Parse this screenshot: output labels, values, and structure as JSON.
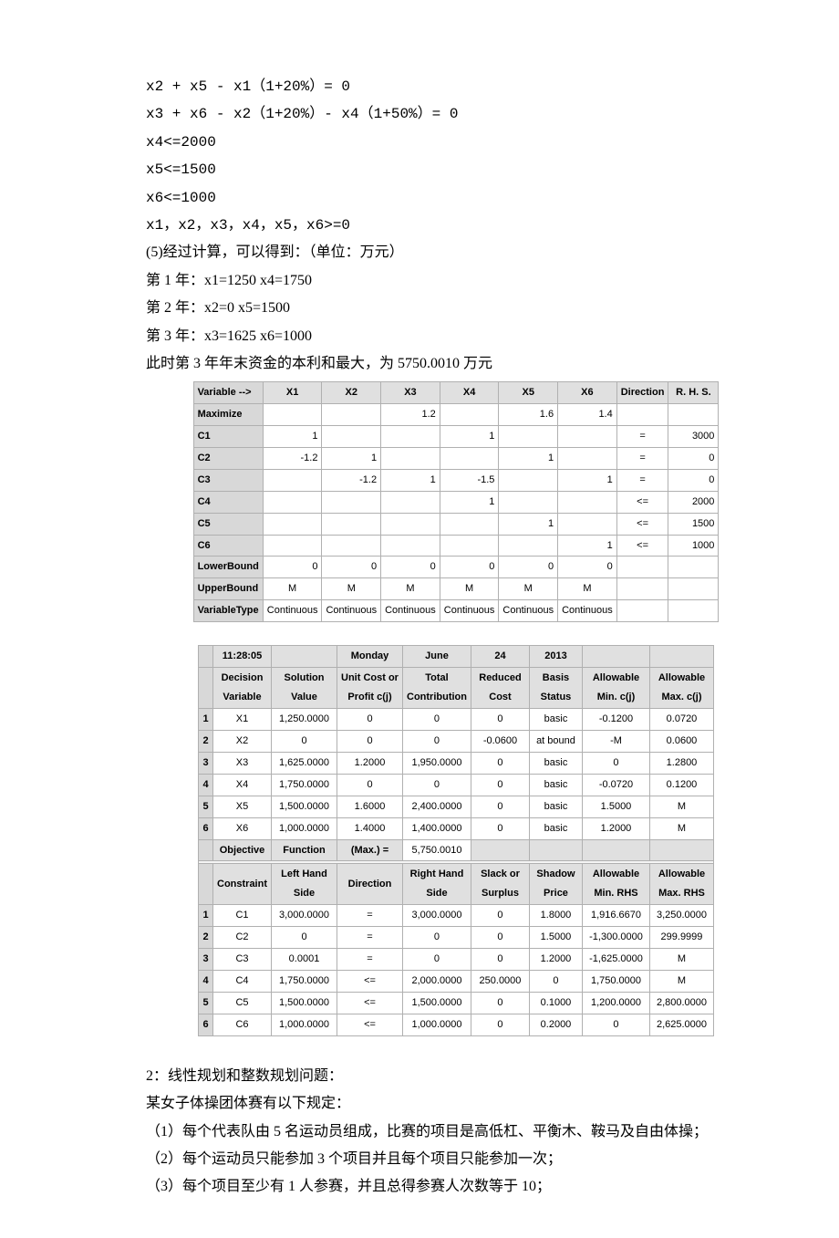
{
  "equations": [
    "x2 + x5 - x1（1+20%）= 0",
    "x3 + x6 - x2（1+20%）- x4（1+50%）= 0",
    "x4<=2000",
    "x5<=1500",
    "x6<=1000",
    "x1，x2，x3，x4，x5，x6>=0"
  ],
  "calc_intro": "(5)经过计算，可以得到：（单位：万元）",
  "year_results": [
    "第 1 年：x1=1250    x4=1750",
    "第 2 年：x2=0          x5=1500",
    "第 3 年：x3=1625    x6=1000"
  ],
  "conclusion": "此时第 3 年年末资金的本利和最大，为 5750.0010 万元",
  "model_table": {
    "headers": [
      "Variable -->",
      "X1",
      "X2",
      "X3",
      "X4",
      "X5",
      "X6",
      "Direction",
      "R. H. S."
    ],
    "rows": [
      {
        "label": "Maximize",
        "cells": [
          "",
          "",
          "1.2",
          "",
          "1.6",
          "1.4",
          "",
          ""
        ]
      },
      {
        "label": "C1",
        "cells": [
          "1",
          "",
          "",
          "1",
          "",
          "",
          "=",
          "3000"
        ]
      },
      {
        "label": "C2",
        "cells": [
          "-1.2",
          "1",
          "",
          "",
          "1",
          "",
          "=",
          "0"
        ]
      },
      {
        "label": "C3",
        "cells": [
          "",
          "-1.2",
          "1",
          "-1.5",
          "",
          "1",
          "=",
          "0"
        ]
      },
      {
        "label": "C4",
        "cells": [
          "",
          "",
          "",
          "1",
          "",
          "",
          "<=",
          "2000"
        ]
      },
      {
        "label": "C5",
        "cells": [
          "",
          "",
          "",
          "",
          "1",
          "",
          "<=",
          "1500"
        ]
      },
      {
        "label": "C6",
        "cells": [
          "",
          "",
          "",
          "",
          "",
          "1",
          "<=",
          "1000"
        ]
      },
      {
        "label": "LowerBound",
        "cells": [
          "0",
          "0",
          "0",
          "0",
          "0",
          "0",
          "",
          ""
        ]
      },
      {
        "label": "UpperBound",
        "cells": [
          "M",
          "M",
          "M",
          "M",
          "M",
          "M",
          "",
          ""
        ]
      },
      {
        "label": "VariableType",
        "cells": [
          "Continuous",
          "Continuous",
          "Continuous",
          "Continuous",
          "Continuous",
          "Continuous",
          "",
          ""
        ]
      }
    ]
  },
  "result_table": {
    "time_row": [
      "11:28:05",
      "",
      "Monday",
      "June",
      "24",
      "2013",
      "",
      ""
    ],
    "headers1": [
      "Decision Variable",
      "Solution Value",
      "Unit Cost or Profit c(j)",
      "Total Contribution",
      "Reduced Cost",
      "Basis Status",
      "Allowable Min. c(j)",
      "Allowable Max. c(j)"
    ],
    "vars": [
      {
        "n": "1",
        "row": [
          "X1",
          "1,250.0000",
          "0",
          "0",
          "0",
          "basic",
          "-0.1200",
          "0.0720"
        ]
      },
      {
        "n": "2",
        "row": [
          "X2",
          "0",
          "0",
          "0",
          "-0.0600",
          "at bound",
          "-M",
          "0.0600"
        ]
      },
      {
        "n": "3",
        "row": [
          "X3",
          "1,625.0000",
          "1.2000",
          "1,950.0000",
          "0",
          "basic",
          "0",
          "1.2800"
        ]
      },
      {
        "n": "4",
        "row": [
          "X4",
          "1,750.0000",
          "0",
          "0",
          "0",
          "basic",
          "-0.0720",
          "0.1200"
        ]
      },
      {
        "n": "5",
        "row": [
          "X5",
          "1,500.0000",
          "1.6000",
          "2,400.0000",
          "0",
          "basic",
          "1.5000",
          "M"
        ]
      },
      {
        "n": "6",
        "row": [
          "X6",
          "1,000.0000",
          "1.4000",
          "1,400.0000",
          "0",
          "basic",
          "1.2000",
          "M"
        ]
      }
    ],
    "objective": [
      "Objective",
      "Function",
      "(Max.) =",
      "5,750.0010",
      "",
      "",
      "",
      ""
    ],
    "headers2": [
      "Constraint",
      "Left Hand Side",
      "Direction",
      "Right Hand Side",
      "Slack or Surplus",
      "Shadow Price",
      "Allowable Min. RHS",
      "Allowable Max. RHS"
    ],
    "cons": [
      {
        "n": "1",
        "row": [
          "C1",
          "3,000.0000",
          "=",
          "3,000.0000",
          "0",
          "1.8000",
          "1,916.6670",
          "3,250.0000"
        ]
      },
      {
        "n": "2",
        "row": [
          "C2",
          "0",
          "=",
          "0",
          "0",
          "1.5000",
          "-1,300.0000",
          "299.9999"
        ]
      },
      {
        "n": "3",
        "row": [
          "C3",
          "0.0001",
          "=",
          "0",
          "0",
          "1.2000",
          "-1,625.0000",
          "M"
        ]
      },
      {
        "n": "4",
        "row": [
          "C4",
          "1,750.0000",
          "<=",
          "2,000.0000",
          "250.0000",
          "0",
          "1,750.0000",
          "M"
        ]
      },
      {
        "n": "5",
        "row": [
          "C5",
          "1,500.0000",
          "<=",
          "1,500.0000",
          "0",
          "0.1000",
          "1,200.0000",
          "2,800.0000"
        ]
      },
      {
        "n": "6",
        "row": [
          "C6",
          "1,000.0000",
          "<=",
          "1,000.0000",
          "0",
          "0.2000",
          "0",
          "2,625.0000"
        ]
      }
    ]
  },
  "bottom": {
    "title": "2：线性规划和整数规划问题：",
    "sub": "某女子体操团体赛有以下规定：",
    "items": [
      "（1）每个代表队由 5 名运动员组成，比赛的项目是高低杠、平衡木、鞍马及自由体操；",
      "（2）每个运动员只能参加 3 个项目并且每个项目只能参加一次；",
      "（3）每个项目至少有 1 人参赛，并且总得参赛人次数等于 10；"
    ]
  }
}
